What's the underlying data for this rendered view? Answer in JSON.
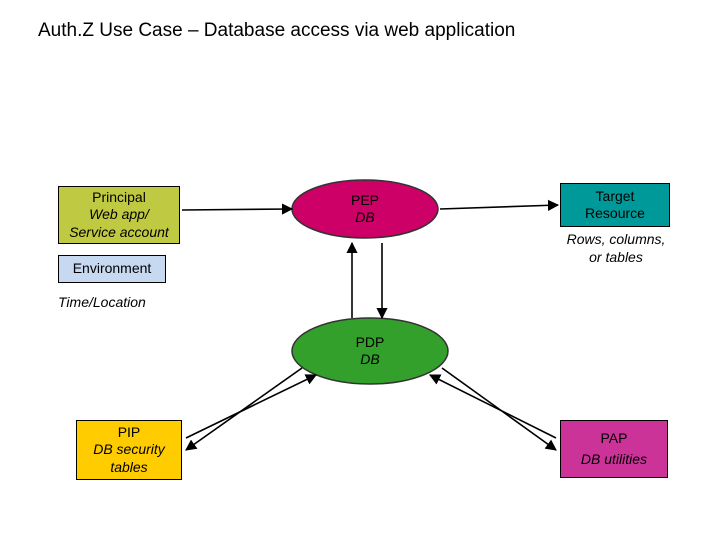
{
  "title": "Auth.Z Use Case – Database access via web application",
  "principal": {
    "title": "Principal",
    "line1": "Web app/",
    "line2": "Service account"
  },
  "environment": {
    "title": "Environment"
  },
  "timelocation": {
    "title": "Time/Location"
  },
  "pep": {
    "title": "PEP",
    "sub": "DB"
  },
  "target": {
    "title": "Target",
    "sub": "Resource"
  },
  "targetDetail": {
    "line1": "Rows, columns,",
    "line2": "or tables"
  },
  "pdp": {
    "title": "PDP",
    "sub": "DB"
  },
  "pip": {
    "title": "PIP",
    "line1": "DB security",
    "line2": "tables"
  },
  "pap": {
    "title": "PAP",
    "sub": "DB utilities"
  },
  "colors": {
    "principal": "#c0c942",
    "environment": "#c6d9f1",
    "pepFill": "#cc0066",
    "pepStroke": "#333333",
    "target": "#009999",
    "pdpFill": "#33a02c",
    "pdpStroke": "#333333",
    "pip": "#ffcc00",
    "pap": "#cc3399"
  }
}
